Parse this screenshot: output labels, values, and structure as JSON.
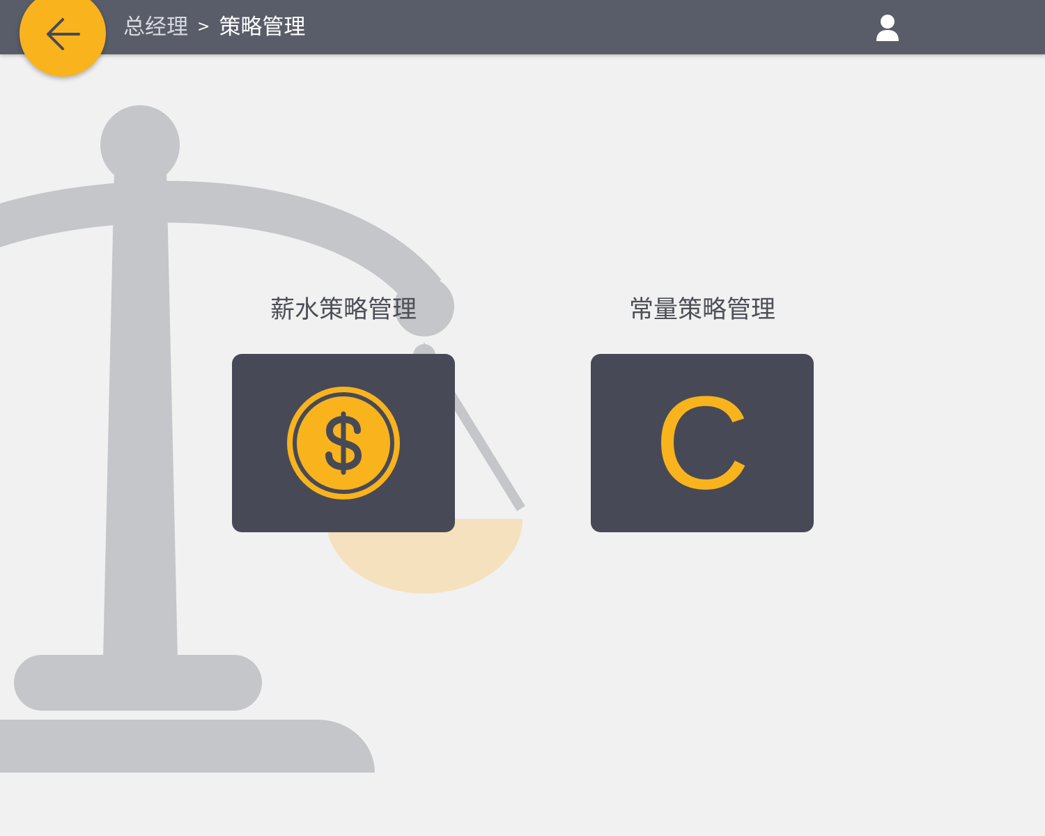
{
  "header": {
    "breadcrumb": {
      "parent": "总经理",
      "separator": ">",
      "current": "策略管理"
    },
    "back_icon": "arrow-left-icon",
    "user_icon": "user-icon"
  },
  "tiles": [
    {
      "label": "薪水策略管理",
      "icon": "dollar-coin-icon"
    },
    {
      "label": "常量策略管理",
      "icon": "letter-c-icon",
      "glyph": "C"
    }
  ],
  "colors": {
    "header_bg": "#595d69",
    "accent": "#f9b31d",
    "tile_bg": "#474a56",
    "page_bg": "#f1f1f1",
    "illustration": "#c5c6ca",
    "illustration_pan": "#f5e1bd"
  }
}
